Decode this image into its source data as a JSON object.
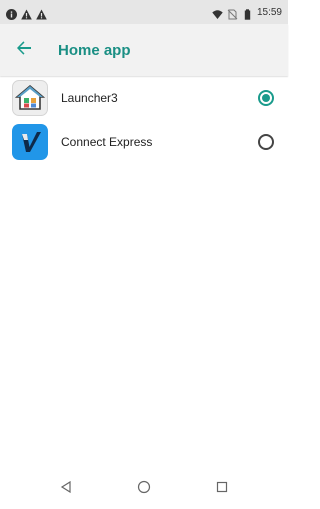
{
  "status_bar": {
    "time": "15:59",
    "left_icons": [
      "info-icon",
      "warning-icon",
      "warning-icon"
    ],
    "right_icons": [
      "wifi-icon",
      "no-sim-icon",
      "battery-icon"
    ]
  },
  "app_bar": {
    "title": "Home app",
    "back_icon": "arrow-back-icon"
  },
  "apps": [
    {
      "label": "Launcher3",
      "icon": "launcher3-house-icon",
      "selected": true
    },
    {
      "label": "Connect Express",
      "icon": "connect-express-v-icon",
      "selected": false
    }
  ],
  "nav_bar": {
    "buttons": [
      "back-triangle-icon",
      "home-circle-icon",
      "recents-square-icon"
    ]
  },
  "colors": {
    "accent": "#1a9b8c",
    "title": "#1a8f84",
    "status_bar_bg": "#e6e6e6",
    "app_bar_bg": "#f2f2f2",
    "connect_icon_bg": "#2196e8"
  }
}
